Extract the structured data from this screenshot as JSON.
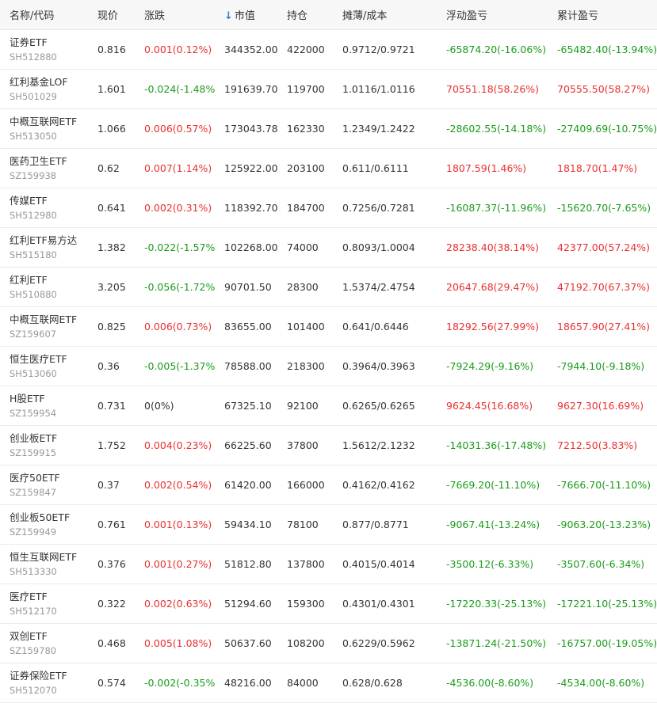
{
  "header": {
    "name_code": "名称/代码",
    "price": "现价",
    "change": "涨跌",
    "market_value_arrow": "↓",
    "market_value": "市值",
    "holding": "持仓",
    "cost": "摊薄/成本",
    "floating_pl": "浮动盈亏",
    "cumulative_pl": "累计盈亏"
  },
  "colors": {
    "up": "#e93030",
    "down": "#1a9c1a",
    "sort_accent": "#2d7ad6"
  },
  "rows": [
    {
      "name": "证券ETF",
      "code": "SH512880",
      "price": "0.816",
      "change": "0.001(0.12%)",
      "change_dir": "up",
      "market_value": "344352.00",
      "holding": "422000",
      "cost": "0.9712/0.9721",
      "floating_pl": "-65874.20(-16.06%)",
      "float_dir": "down",
      "cumulative_pl": "-65482.40(-13.94%)",
      "cum_dir": "down"
    },
    {
      "name": "红利基金LOF",
      "code": "SH501029",
      "price": "1.601",
      "change": "-0.024(-1.48%)",
      "change_dir": "down",
      "market_value": "191639.70",
      "holding": "119700",
      "cost": "1.0116/1.0116",
      "floating_pl": "70551.18(58.26%)",
      "float_dir": "up",
      "cumulative_pl": "70555.50(58.27%)",
      "cum_dir": "up"
    },
    {
      "name": "中概互联网ETF",
      "code": "SH513050",
      "price": "1.066",
      "change": "0.006(0.57%)",
      "change_dir": "up",
      "market_value": "173043.78",
      "holding": "162330",
      "cost": "1.2349/1.2422",
      "floating_pl": "-28602.55(-14.18%)",
      "float_dir": "down",
      "cumulative_pl": "-27409.69(-10.75%)",
      "cum_dir": "down"
    },
    {
      "name": "医药卫生ETF",
      "code": "SZ159938",
      "price": "0.62",
      "change": "0.007(1.14%)",
      "change_dir": "up",
      "market_value": "125922.00",
      "holding": "203100",
      "cost": "0.611/0.6111",
      "floating_pl": "1807.59(1.46%)",
      "float_dir": "up",
      "cumulative_pl": "1818.70(1.47%)",
      "cum_dir": "up"
    },
    {
      "name": "传媒ETF",
      "code": "SH512980",
      "price": "0.641",
      "change": "0.002(0.31%)",
      "change_dir": "up",
      "market_value": "118392.70",
      "holding": "184700",
      "cost": "0.7256/0.7281",
      "floating_pl": "-16087.37(-11.96%)",
      "float_dir": "down",
      "cumulative_pl": "-15620.70(-7.65%)",
      "cum_dir": "down"
    },
    {
      "name": "红利ETF易方达",
      "code": "SH515180",
      "price": "1.382",
      "change": "-0.022(-1.57%)",
      "change_dir": "down",
      "market_value": "102268.00",
      "holding": "74000",
      "cost": "0.8093/1.0004",
      "floating_pl": "28238.40(38.14%)",
      "float_dir": "up",
      "cumulative_pl": "42377.00(57.24%)",
      "cum_dir": "up"
    },
    {
      "name": "红利ETF",
      "code": "SH510880",
      "price": "3.205",
      "change": "-0.056(-1.72%)",
      "change_dir": "down",
      "market_value": "90701.50",
      "holding": "28300",
      "cost": "1.5374/2.4754",
      "floating_pl": "20647.68(29.47%)",
      "float_dir": "up",
      "cumulative_pl": "47192.70(67.37%)",
      "cum_dir": "up"
    },
    {
      "name": "中概互联网ETF",
      "code": "SZ159607",
      "price": "0.825",
      "change": "0.006(0.73%)",
      "change_dir": "up",
      "market_value": "83655.00",
      "holding": "101400",
      "cost": "0.641/0.6446",
      "floating_pl": "18292.56(27.99%)",
      "float_dir": "up",
      "cumulative_pl": "18657.90(27.41%)",
      "cum_dir": "up"
    },
    {
      "name": "恒生医疗ETF",
      "code": "SH513060",
      "price": "0.36",
      "change": "-0.005(-1.37%)",
      "change_dir": "down",
      "market_value": "78588.00",
      "holding": "218300",
      "cost": "0.3964/0.3963",
      "floating_pl": "-7924.29(-9.16%)",
      "float_dir": "down",
      "cumulative_pl": "-7944.10(-9.18%)",
      "cum_dir": "down"
    },
    {
      "name": "H股ETF",
      "code": "SZ159954",
      "price": "0.731",
      "change": "0(0%)",
      "change_dir": "flat",
      "market_value": "67325.10",
      "holding": "92100",
      "cost": "0.6265/0.6265",
      "floating_pl": "9624.45(16.68%)",
      "float_dir": "up",
      "cumulative_pl": "9627.30(16.69%)",
      "cum_dir": "up"
    },
    {
      "name": "创业板ETF",
      "code": "SZ159915",
      "price": "1.752",
      "change": "0.004(0.23%)",
      "change_dir": "up",
      "market_value": "66225.60",
      "holding": "37800",
      "cost": "1.5612/2.1232",
      "floating_pl": "-14031.36(-17.48%)",
      "float_dir": "down",
      "cumulative_pl": "7212.50(3.83%)",
      "cum_dir": "up"
    },
    {
      "name": "医疗50ETF",
      "code": "SZ159847",
      "price": "0.37",
      "change": "0.002(0.54%)",
      "change_dir": "up",
      "market_value": "61420.00",
      "holding": "166000",
      "cost": "0.4162/0.4162",
      "floating_pl": "-7669.20(-11.10%)",
      "float_dir": "down",
      "cumulative_pl": "-7666.70(-11.10%)",
      "cum_dir": "down"
    },
    {
      "name": "创业板50ETF",
      "code": "SZ159949",
      "price": "0.761",
      "change": "0.001(0.13%)",
      "change_dir": "up",
      "market_value": "59434.10",
      "holding": "78100",
      "cost": "0.877/0.8771",
      "floating_pl": "-9067.41(-13.24%)",
      "float_dir": "down",
      "cumulative_pl": "-9063.20(-13.23%)",
      "cum_dir": "down"
    },
    {
      "name": "恒生互联网ETF",
      "code": "SH513330",
      "price": "0.376",
      "change": "0.001(0.27%)",
      "change_dir": "up",
      "market_value": "51812.80",
      "holding": "137800",
      "cost": "0.4015/0.4014",
      "floating_pl": "-3500.12(-6.33%)",
      "float_dir": "down",
      "cumulative_pl": "-3507.60(-6.34%)",
      "cum_dir": "down"
    },
    {
      "name": "医疗ETF",
      "code": "SH512170",
      "price": "0.322",
      "change": "0.002(0.63%)",
      "change_dir": "up",
      "market_value": "51294.60",
      "holding": "159300",
      "cost": "0.4301/0.4301",
      "floating_pl": "-17220.33(-25.13%)",
      "float_dir": "down",
      "cumulative_pl": "-17221.10(-25.13%)",
      "cum_dir": "down"
    },
    {
      "name": "双创ETF",
      "code": "SZ159780",
      "price": "0.468",
      "change": "0.005(1.08%)",
      "change_dir": "up",
      "market_value": "50637.60",
      "holding": "108200",
      "cost": "0.6229/0.5962",
      "floating_pl": "-13871.24(-21.50%)",
      "float_dir": "down",
      "cumulative_pl": "-16757.00(-19.05%)",
      "cum_dir": "down"
    },
    {
      "name": "证券保险ETF",
      "code": "SH512070",
      "price": "0.574",
      "change": "-0.002(-0.35%)",
      "change_dir": "down",
      "market_value": "48216.00",
      "holding": "84000",
      "cost": "0.628/0.628",
      "floating_pl": "-4536.00(-8.60%)",
      "float_dir": "down",
      "cumulative_pl": "-4534.00(-8.60%)",
      "cum_dir": "down"
    }
  ]
}
